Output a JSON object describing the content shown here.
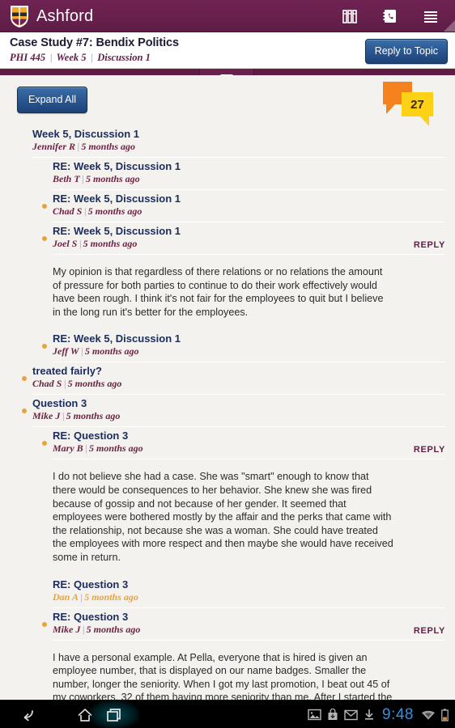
{
  "appbar": {
    "brand": "Ashford",
    "logo_icon": "shield-logo-icon",
    "actions": [
      {
        "name": "library-icon",
        "label": "Library"
      },
      {
        "name": "contact-phone-icon",
        "label": "Contact"
      },
      {
        "name": "hamburger-menu-icon",
        "label": "Menu"
      }
    ],
    "bg_color": "#68214d"
  },
  "titlebar": {
    "title": "Case Study #7: Bendix Politics",
    "course": "PHI 445",
    "week": "Week 5",
    "discussion": "Discussion 1",
    "reply_button": "Reply to Topic",
    "reply_button_color": "#2c5993"
  },
  "pulltab": {
    "icon": "chevron-down-icon"
  },
  "toolbar": {
    "expand_all_label": "Expand All",
    "badge_count": "27",
    "badge_icon": "speech-bubbles-icon",
    "badge_colors": {
      "back": "#f5821f",
      "front": "#fcd116"
    }
  },
  "thread": {
    "dot_color": "#e8a33d",
    "reply_label": "REPLY",
    "separator": "|",
    "nodes": [
      {
        "title": "Week 5, Discussion 1",
        "author": "Jennifer R",
        "time": "5 months ago",
        "level": 0,
        "unread": false,
        "dot": false,
        "reply": false,
        "body": ""
      },
      {
        "title": "RE: Week 5, Discussion 1",
        "author": "Beth T",
        "time": "5 months ago",
        "level": 1,
        "unread": false,
        "dot": false,
        "reply": false,
        "body": ""
      },
      {
        "title": "RE: Week 5, Discussion 1",
        "author": "Chad S",
        "time": "5 months ago",
        "level": 1,
        "unread": false,
        "dot": true,
        "reply": false,
        "body": ""
      },
      {
        "title": "RE: Week 5, Discussion 1",
        "author": "Joel S",
        "time": "5 months ago",
        "level": 1,
        "unread": false,
        "dot": true,
        "reply": true,
        "body": "  My opinion is that regardless of there relations or no relations the amount of pressure for both parties to continue to do their work effectively would have been rough.  I think it's not fair for the employees to quit but I believe in the long run it's better for the employees."
      },
      {
        "title": "RE: Week 5, Discussion 1",
        "author": "Jeff W",
        "time": "5 months ago",
        "level": 1,
        "unread": false,
        "dot": true,
        "reply": false,
        "body": ""
      },
      {
        "title": "treated fairly?",
        "author": "Chad S",
        "time": "5 months ago",
        "level": 0,
        "unread": false,
        "dot": true,
        "reply": false,
        "body": ""
      },
      {
        "title": "Question 3",
        "author": "Mike J",
        "time": "5 months ago",
        "level": 0,
        "unread": false,
        "dot": true,
        "reply": false,
        "body": ""
      },
      {
        "title": "RE: Question 3",
        "author": "Mary B",
        "time": "5 months ago",
        "level": 1,
        "unread": false,
        "dot": true,
        "reply": true,
        "body": "I do not believe she had a case.  She was \"smart\" enough to know that there would be consequences to her behavior.  She knew she was fired because of gossip and not because of her gender.  It seemed that employees were bothered mostly by the affair and the perks that came with the relationship, not because she was a woman.  She could have treated the employees with more respect and then maybe she would have received some in return."
      },
      {
        "title": "RE: Question 3",
        "author": "Dan A",
        "time": "5 months ago",
        "level": 1,
        "unread": true,
        "dot": false,
        "reply": false,
        "body": ""
      },
      {
        "title": "RE: Question 3",
        "author": "Mike J",
        "time": "5 months ago",
        "level": 1,
        "unread": false,
        "dot": true,
        "reply": true,
        "body": " I have a personal example.  At Pella, everyone that is hired is given an employee number, that is displayed on our name badges.  Smaller the number, longer the seniority.  When I got my last promotion, I beat out 45 of my coworkers, 32 of them having more seniority than me.  After I started the job, I received as much hazing as"
      }
    ]
  },
  "navbar": {
    "buttons": [
      {
        "name": "nav-back-icon",
        "label": "Back"
      },
      {
        "name": "nav-home-icon",
        "label": "Home"
      },
      {
        "name": "nav-recents-icon",
        "label": "Recent apps"
      }
    ],
    "status": {
      "icons": [
        {
          "name": "screenshot-image-icon"
        },
        {
          "name": "app-install-icon"
        },
        {
          "name": "gmail-envelope-icon"
        },
        {
          "name": "download-icon"
        }
      ],
      "clock": "9:48",
      "clock_color": "#3a8fd6",
      "wifi_icon": "wifi-icon",
      "battery_icon": "battery-icon"
    }
  }
}
